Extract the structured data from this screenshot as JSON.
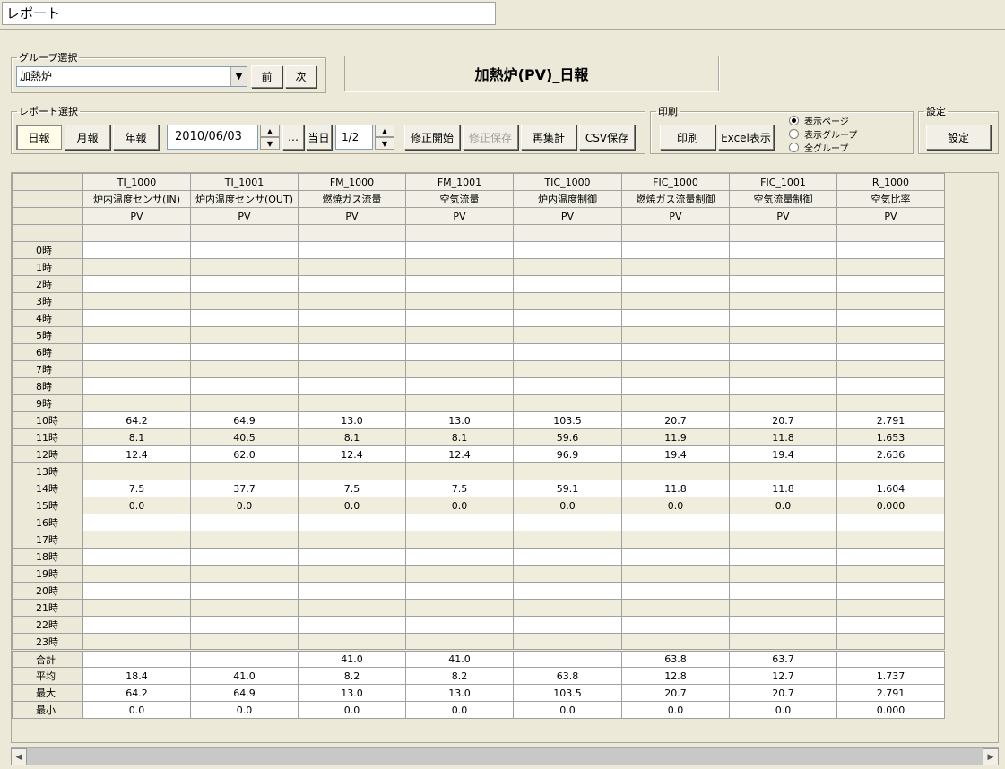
{
  "window_title": "レポート",
  "group_select": {
    "legend": "グループ選択",
    "value": "加熱炉",
    "prev_label": "前",
    "next_label": "次"
  },
  "report_title": "加熱炉(PV)_日報",
  "report_select": {
    "legend": "レポート選択",
    "daily_label": "日報",
    "monthly_label": "月報",
    "yearly_label": "年報",
    "date_value": "2010/06/03",
    "ellipsis_label": "…",
    "today_label": "当日",
    "page_value": "1/2",
    "edit_start_label": "修正開始",
    "edit_save_label": "修正保存",
    "recalc_label": "再集計",
    "csv_save_label": "CSV保存"
  },
  "print": {
    "legend": "印刷",
    "print_label": "印刷",
    "excel_label": "Excel表示",
    "radio": [
      {
        "label": "表示ページ",
        "checked": true
      },
      {
        "label": "表示グループ",
        "checked": false
      },
      {
        "label": "全グループ",
        "checked": false
      }
    ]
  },
  "settings": {
    "legend": "設定",
    "button_label": "設定"
  },
  "columns": [
    {
      "tag": "TI_1000",
      "desc": "炉内温度センサ(IN)",
      "type": "PV"
    },
    {
      "tag": "TI_1001",
      "desc": "炉内温度センサ(OUT)",
      "type": "PV"
    },
    {
      "tag": "FM_1000",
      "desc": "燃焼ガス流量",
      "type": "PV"
    },
    {
      "tag": "FM_1001",
      "desc": "空気流量",
      "type": "PV"
    },
    {
      "tag": "TIC_1000",
      "desc": "炉内温度制御",
      "type": "PV"
    },
    {
      "tag": "FIC_1000",
      "desc": "燃焼ガス流量制御",
      "type": "PV"
    },
    {
      "tag": "FIC_1001",
      "desc": "空気流量制御",
      "type": "PV"
    },
    {
      "tag": "R_1000",
      "desc": "空気比率",
      "type": "PV"
    }
  ],
  "rows": [
    {
      "label": "0時",
      "values": [
        "",
        "",
        "",
        "",
        "",
        "",
        "",
        ""
      ]
    },
    {
      "label": "1時",
      "values": [
        "",
        "",
        "",
        "",
        "",
        "",
        "",
        ""
      ]
    },
    {
      "label": "2時",
      "values": [
        "",
        "",
        "",
        "",
        "",
        "",
        "",
        ""
      ]
    },
    {
      "label": "3時",
      "values": [
        "",
        "",
        "",
        "",
        "",
        "",
        "",
        ""
      ]
    },
    {
      "label": "4時",
      "values": [
        "",
        "",
        "",
        "",
        "",
        "",
        "",
        ""
      ]
    },
    {
      "label": "5時",
      "values": [
        "",
        "",
        "",
        "",
        "",
        "",
        "",
        ""
      ]
    },
    {
      "label": "6時",
      "values": [
        "",
        "",
        "",
        "",
        "",
        "",
        "",
        ""
      ]
    },
    {
      "label": "7時",
      "values": [
        "",
        "",
        "",
        "",
        "",
        "",
        "",
        ""
      ]
    },
    {
      "label": "8時",
      "values": [
        "",
        "",
        "",
        "",
        "",
        "",
        "",
        ""
      ]
    },
    {
      "label": "9時",
      "values": [
        "",
        "",
        "",
        "",
        "",
        "",
        "",
        ""
      ]
    },
    {
      "label": "10時",
      "values": [
        "64.2",
        "64.9",
        "13.0",
        "13.0",
        "103.5",
        "20.7",
        "20.7",
        "2.791"
      ]
    },
    {
      "label": "11時",
      "values": [
        "8.1",
        "40.5",
        "8.1",
        "8.1",
        "59.6",
        "11.9",
        "11.8",
        "1.653"
      ]
    },
    {
      "label": "12時",
      "values": [
        "12.4",
        "62.0",
        "12.4",
        "12.4",
        "96.9",
        "19.4",
        "19.4",
        "2.636"
      ]
    },
    {
      "label": "13時",
      "values": [
        "",
        "",
        "",
        "",
        "",
        "",
        "",
        ""
      ]
    },
    {
      "label": "14時",
      "values": [
        "7.5",
        "37.7",
        "7.5",
        "7.5",
        "59.1",
        "11.8",
        "11.8",
        "1.604"
      ]
    },
    {
      "label": "15時",
      "values": [
        "0.0",
        "0.0",
        "0.0",
        "0.0",
        "0.0",
        "0.0",
        "0.0",
        "0.000"
      ]
    },
    {
      "label": "16時",
      "values": [
        "",
        "",
        "",
        "",
        "",
        "",
        "",
        ""
      ]
    },
    {
      "label": "17時",
      "values": [
        "",
        "",
        "",
        "",
        "",
        "",
        "",
        ""
      ]
    },
    {
      "label": "18時",
      "values": [
        "",
        "",
        "",
        "",
        "",
        "",
        "",
        ""
      ]
    },
    {
      "label": "19時",
      "values": [
        "",
        "",
        "",
        "",
        "",
        "",
        "",
        ""
      ]
    },
    {
      "label": "20時",
      "values": [
        "",
        "",
        "",
        "",
        "",
        "",
        "",
        ""
      ]
    },
    {
      "label": "21時",
      "values": [
        "",
        "",
        "",
        "",
        "",
        "",
        "",
        ""
      ]
    },
    {
      "label": "22時",
      "values": [
        "",
        "",
        "",
        "",
        "",
        "",
        "",
        ""
      ]
    },
    {
      "label": "23時",
      "values": [
        "",
        "",
        "",
        "",
        "",
        "",
        "",
        ""
      ]
    }
  ],
  "summary": [
    {
      "label": "合計",
      "values": [
        "",
        "",
        "41.0",
        "41.0",
        "",
        "63.8",
        "63.7",
        ""
      ]
    },
    {
      "label": "平均",
      "values": [
        "18.4",
        "41.0",
        "8.2",
        "8.2",
        "63.8",
        "12.8",
        "12.7",
        "1.737"
      ]
    },
    {
      "label": "最大",
      "values": [
        "64.2",
        "64.9",
        "13.0",
        "13.0",
        "103.5",
        "20.7",
        "20.7",
        "2.791"
      ]
    },
    {
      "label": "最小",
      "values": [
        "0.0",
        "0.0",
        "0.0",
        "0.0",
        "0.0",
        "0.0",
        "0.0",
        "0.000"
      ]
    }
  ]
}
